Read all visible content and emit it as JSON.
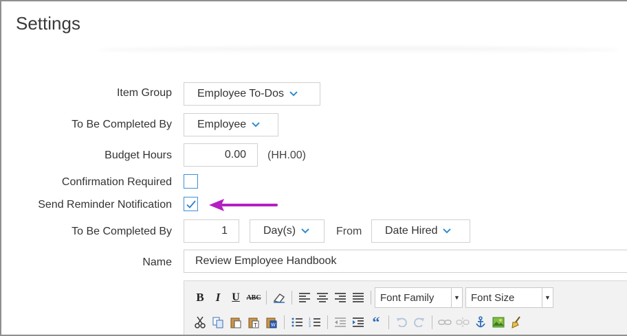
{
  "header": {
    "title": "Settings"
  },
  "form": {
    "item_group": {
      "label": "Item Group",
      "value": "Employee To-Dos"
    },
    "completed_by_role": {
      "label": "To Be Completed By",
      "value": "Employee"
    },
    "budget_hours": {
      "label": "Budget Hours",
      "value": "0.00",
      "hint": "(HH.00)"
    },
    "confirmation_required": {
      "label": "Confirmation Required",
      "checked": false
    },
    "send_reminder": {
      "label": "Send Reminder Notification",
      "checked": true
    },
    "completed_by_time": {
      "label": "To Be Completed By",
      "amount": "1",
      "unit": "Day(s)",
      "from_label": "From",
      "from_value": "Date Hired"
    },
    "name": {
      "label": "Name",
      "value": "Review Employee Handbook"
    }
  },
  "editor_toolbar": {
    "row1": [
      "bold-icon",
      "italic-icon",
      "underline-icon",
      "strikethrough-icon",
      "eraser-icon",
      "align-left-icon",
      "align-center-icon",
      "align-right-icon",
      "align-justify-icon"
    ],
    "font_family": "Font Family",
    "font_size": "Font Size",
    "row2": [
      "cut-icon",
      "copy-icon",
      "paste-icon",
      "paste-text-icon",
      "paste-word-icon",
      "bullet-list-icon",
      "numbered-list-icon",
      "outdent-icon",
      "indent-icon",
      "blockquote-icon",
      "undo-icon",
      "redo-icon",
      "link-icon",
      "unlink-icon",
      "anchor-icon",
      "image-icon",
      "cleanup-icon"
    ]
  },
  "colors": {
    "accent": "#2f8dd1",
    "arrow": "#b41fc2",
    "border": "#d0d0d0"
  }
}
